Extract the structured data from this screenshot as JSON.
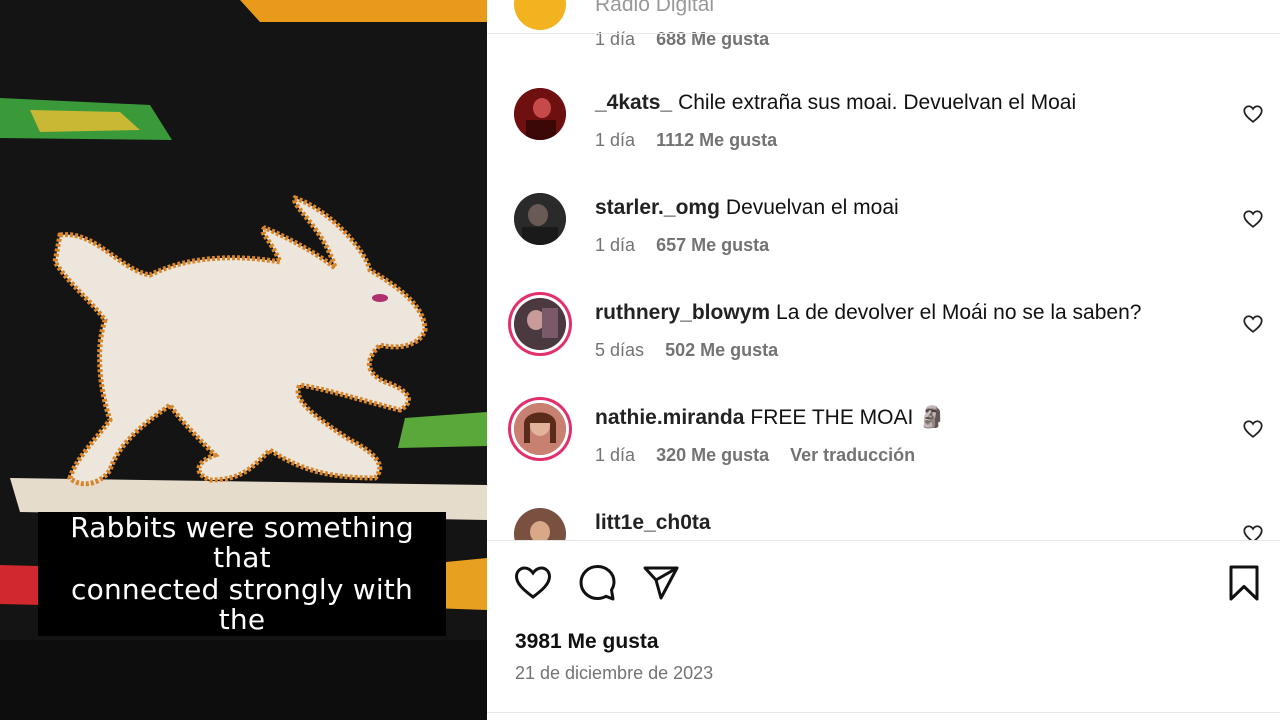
{
  "media": {
    "caption_lines": [
      "Rabbits were something that",
      "connected strongly with the"
    ]
  },
  "partial_top": {
    "username_partial": "Radio Digital",
    "time": "1 día",
    "likes": "688 Me gusta"
  },
  "comments": [
    {
      "username": "_4kats_",
      "text": "Chile extraña sus moai. Devuelvan el Moai",
      "time": "1 día",
      "likes": "1112 Me gusta",
      "extra": "",
      "avatar_color": "#8b1a1a",
      "ring": false
    },
    {
      "username": "starler._omg",
      "text": "Devuelvan el moai",
      "time": "1 día",
      "likes": "657 Me gusta",
      "extra": "",
      "avatar_color": "#3a3a3a",
      "ring": false
    },
    {
      "username": "ruthnery_blowym",
      "text": "La de devolver el Moái no se la saben?",
      "time": "5 días",
      "likes": "502 Me gusta",
      "extra": "",
      "avatar_color": "#5c4850",
      "ring": true
    },
    {
      "username": "nathie.miranda",
      "text": "FREE THE MOAI 🗿",
      "time": "1 día",
      "likes": "320 Me gusta",
      "extra": "Ver traducción",
      "avatar_color": "#a0524d",
      "ring": true
    },
    {
      "username": "litt1e_ch0ta",
      "text": "",
      "time": "",
      "likes": "",
      "extra": "",
      "avatar_color": "#9a7060",
      "ring": false
    }
  ],
  "actions": {
    "icons": [
      "heart-icon",
      "comment-icon",
      "share-icon",
      "bookmark-icon"
    ],
    "likes_total": "3981 Me gusta",
    "date": "21 de diciembre de 2023"
  },
  "colors": {
    "story_ring": "#e1306c",
    "meta_gray": "#737373"
  }
}
